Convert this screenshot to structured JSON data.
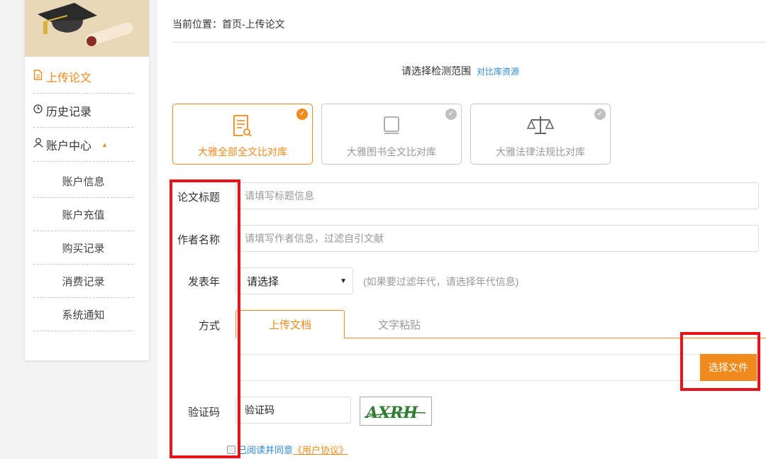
{
  "colors": {
    "accent": "#f08a1c",
    "link": "#2b8ad8",
    "annotation": "#e8121b"
  },
  "sidebar": {
    "items": [
      {
        "label": "上传论文",
        "icon": "document-icon",
        "active": true
      },
      {
        "label": "历史记录",
        "icon": "clock-icon"
      },
      {
        "label": "账户中心",
        "icon": "user-icon",
        "expanded": true
      }
    ],
    "subitems": [
      "账户信息",
      "账户充值",
      "购买记录",
      "消费记录",
      "系统通知"
    ]
  },
  "breadcrumb": "当前位置：首页-上传论文",
  "scope": {
    "label": "请选择检测范围",
    "link": "对比库资源"
  },
  "libraries": [
    {
      "label": "大雅全部全文比对库",
      "icon": "document-search-icon",
      "selected": true
    },
    {
      "label": "大雅图书全文比对库",
      "icon": "book-icon",
      "selected": false
    },
    {
      "label": "大雅法律法规比对库",
      "icon": "scales-icon",
      "selected": false
    }
  ],
  "form": {
    "title_label": "论文标题",
    "title_placeholder": "请填写标题信息",
    "author_label": "作者名称",
    "author_placeholder": "请填写作者信息，过滤自引文献",
    "year_label": "发表年",
    "year_value": "请选择",
    "year_hint": "(如果要过滤年代，请选择年代信息)",
    "method_label": "方式",
    "tabs": [
      "上传文档",
      "文字粘贴"
    ],
    "file_button": "选择文件",
    "captcha_label": "验证码",
    "captcha_placeholder": "验证码",
    "captcha_text": "AXRH"
  },
  "agreement": {
    "text": "已阅读并同意",
    "link": "《用户协议》"
  }
}
